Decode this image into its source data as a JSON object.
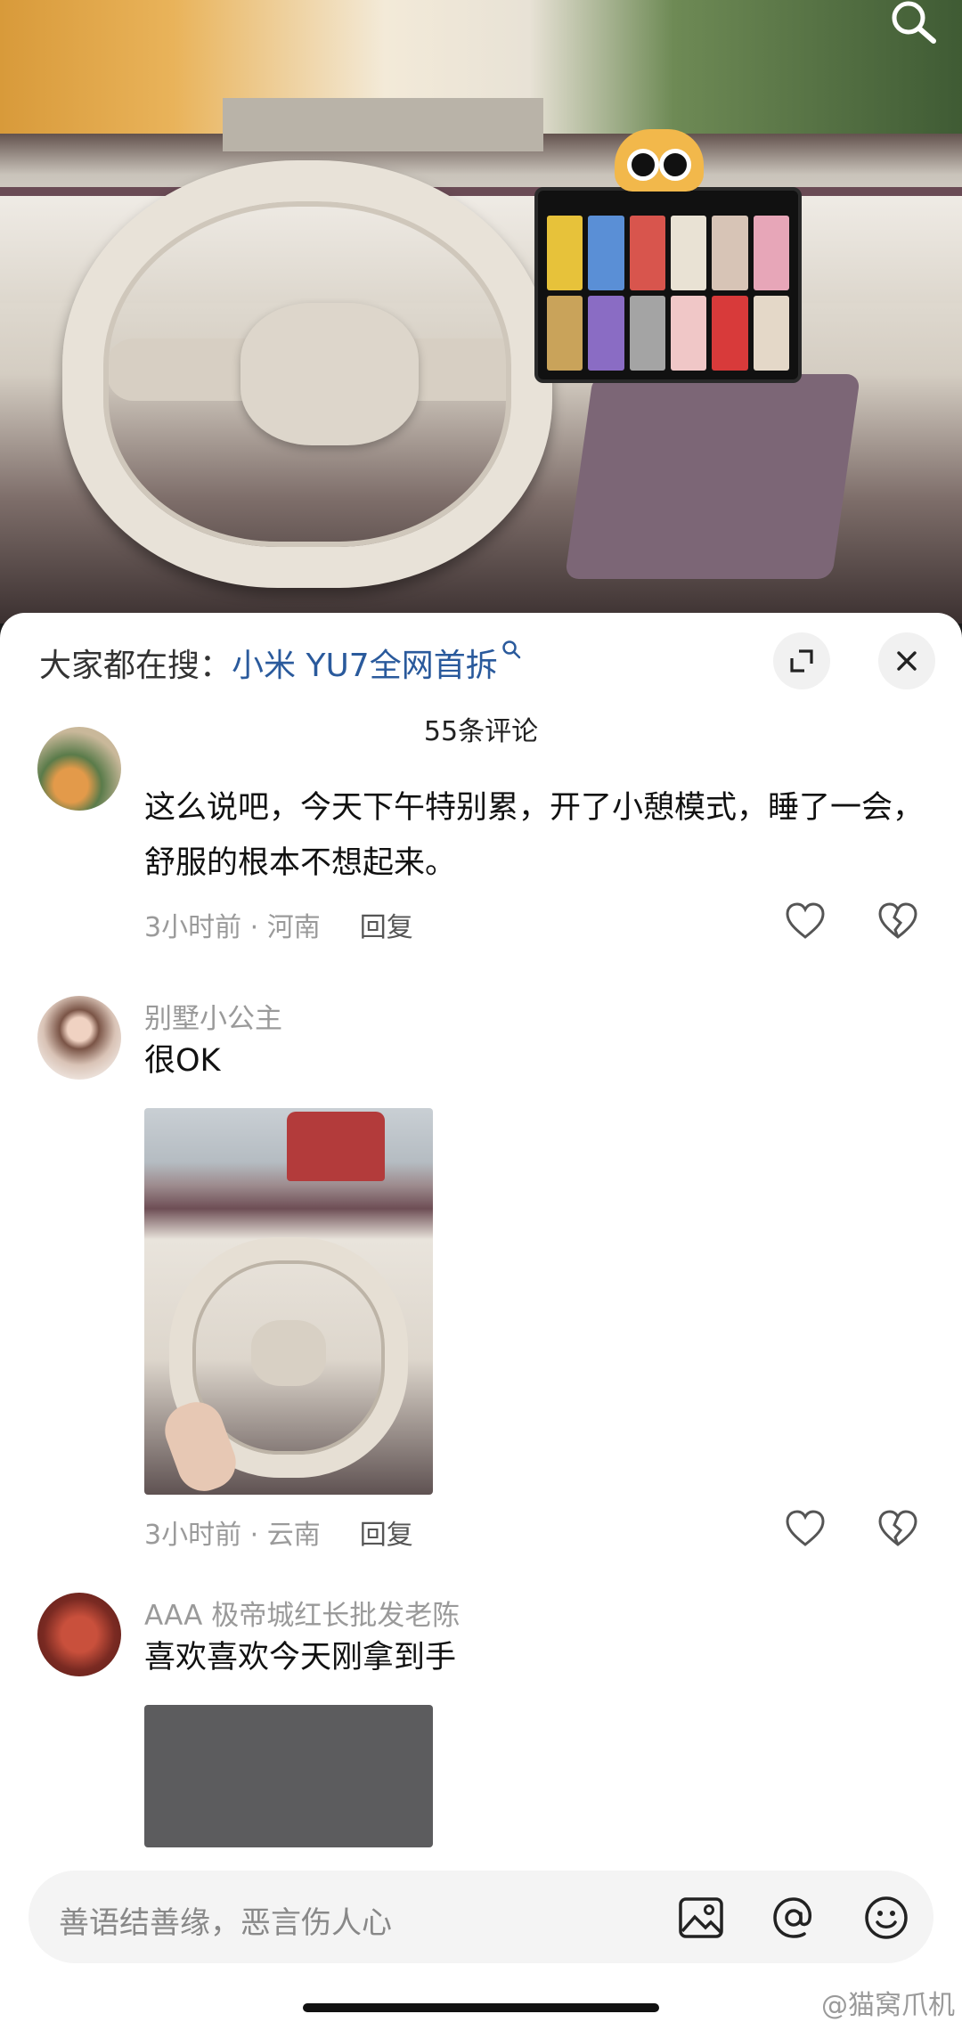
{
  "search_hint": {
    "prefix": "大家都在搜：",
    "keyword": "小米 YU7全网首拆"
  },
  "comment_count": "55条评论",
  "comments": [
    {
      "username": "",
      "text": "这么说吧，今天下午特别累，开了小憩模式，睡了一会，舒服的根本不想起来。",
      "time_location": "3小时前 · 河南",
      "reply": "回复"
    },
    {
      "username": "别墅小公主",
      "text": "很OK",
      "time_location": "3小时前 · 云南",
      "reply": "回复"
    },
    {
      "username": "AAA 极帝城红长批发老陈",
      "text": "喜欢喜欢今天刚拿到手"
    }
  ],
  "input": {
    "placeholder": "善语结善缘，恶言伤人心"
  },
  "watermark": "@猫窝爪机",
  "colors": {
    "keyword": "#2a5a9c",
    "meta": "#9a9a9a",
    "sheet_bg": "#ffffff"
  }
}
